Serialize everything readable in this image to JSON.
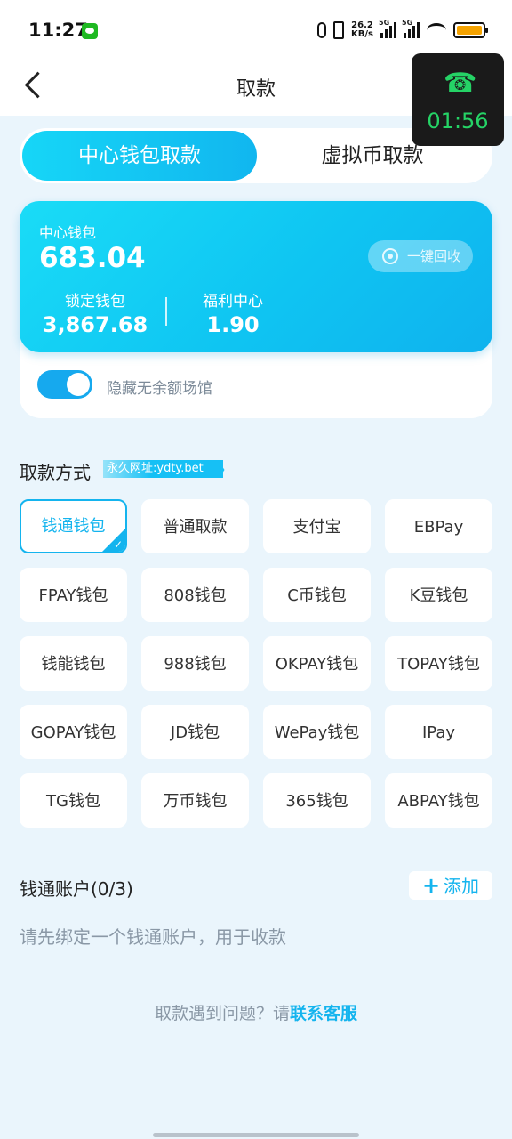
{
  "statusbar": {
    "time": "11:27",
    "speed_value": "26.2",
    "speed_unit": "KB/s",
    "sig1": "5G",
    "sig2": "5G"
  },
  "call": {
    "timer": "01:56"
  },
  "header": {
    "title": "取款"
  },
  "tabs": [
    {
      "label": "中心钱包取款",
      "active": true
    },
    {
      "label": "虚拟币取款",
      "active": false
    }
  ],
  "wallet": {
    "center_label": "中心钱包",
    "center_amount": "683.04",
    "recycle_label": "一键回收",
    "locked_label": "锁定钱包",
    "locked_amount": "3,867.68",
    "welfare_label": "福利中心",
    "welfare_amount": "1.90",
    "hide_toggle_label": "隐藏无余额场馆",
    "hide_toggle_on": true
  },
  "methods": {
    "title": "取款方式",
    "url_badge": "永久网址:ydty.bet",
    "items": [
      "钱通钱包",
      "普通取款",
      "支付宝",
      "EBPay",
      "FPAY钱包",
      "808钱包",
      "C币钱包",
      "K豆钱包",
      "钱能钱包",
      "988钱包",
      "OKPAY钱包",
      "TOPAY钱包",
      "GOPAY钱包",
      "JD钱包",
      "WePay钱包",
      "IPay",
      "TG钱包",
      "万币钱包",
      "365钱包",
      "ABPAY钱包"
    ],
    "selected": "钱通钱包"
  },
  "account": {
    "title": "钱通账户(0/3)",
    "add_label": "添加",
    "hint": "请先绑定一个钱通账户，用于收款"
  },
  "help": {
    "question": "取款遇到问题？请",
    "link": "联系客服"
  }
}
